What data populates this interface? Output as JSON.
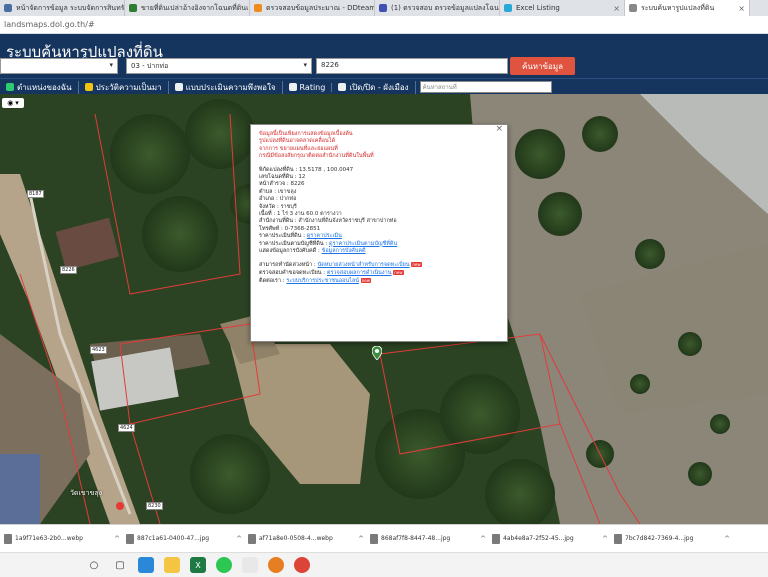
{
  "browser": {
    "tabs": [
      {
        "label": "หน้าจัดการข้อมูล ระบบจัดการสินทรัพย์ CST11",
        "color": "#4a6fa5",
        "active": false
      },
      {
        "label": "ขายที่ดินเปล่าอ้างอิงจากโฉนดที่ดินเลขที่ (4...",
        "color": "#2e7d32",
        "active": false
      },
      {
        "label": "ตรวจสอบข้อมูลประมาณ - DDteamian",
        "color": "#ef8a1f",
        "active": false
      },
      {
        "label": "(1) ตรวจสอบ ตรวจข้อมูลแปลงโฉนดปาก...",
        "color": "#3f51b5",
        "active": false
      },
      {
        "label": "Excel Listing",
        "color": "#2aa8d8",
        "active": false
      },
      {
        "label": "ระบบค้นหารูปแปลงที่ดิน",
        "color": "#888888",
        "active": true
      }
    ],
    "url": "landsmaps.dol.go.th/#"
  },
  "app": {
    "title": "ระบบค้นหารูปแปลงที่ดิน",
    "province_value": "",
    "district_value": "03 - ปากท่อ",
    "parcel_value": "8226",
    "search_label": "ค้นหาข้อมูล",
    "accent": "#e0533f",
    "header_color": "#16355e"
  },
  "toolbar": {
    "items": [
      {
        "label": "ตำแหน่งของฉัน",
        "icon": "location-icon",
        "color": "#2ecc71"
      },
      {
        "label": "ประวัติความเป็นมา",
        "icon": "history-icon",
        "color": "#f1c40f"
      },
      {
        "label": "แบบประเมินความพึงพอใจ",
        "icon": "survey-icon",
        "color": "#ecf0f1"
      },
      {
        "label": "Rating",
        "icon": "rating-icon",
        "color": "#ecf0f1"
      },
      {
        "label": "เปิด/ปิด - ผังเมือง",
        "icon": "toggle-icon",
        "color": "#ecf0f1"
      }
    ],
    "search_placeholder": "ค้นหาสถานที่"
  },
  "popup": {
    "warnings": [
      "ข้อมูลนี้เป็นเพียงการแสดงข้อมูลเบื้องต้น",
      "รูปแปลงที่ดินอาจคลาดเคลื่อนได้",
      "จากการ ขยายแผนที่และย่อแผนที่",
      "กรณีมีข้อสงสัยกรุณาติดต่อสำนักงานที่ดินในพื้นที่"
    ],
    "fields": [
      {
        "label": "พิกัดแปลงที่ดิน",
        "value": "13.5178 , 100.0047"
      },
      {
        "label": "เลขโฉนดที่ดิน",
        "value": "12"
      },
      {
        "label": "หน้าสำรวจ",
        "value": "8226"
      },
      {
        "label": "ตำบล",
        "value": "เขาขลุง"
      },
      {
        "label": "อำเภอ",
        "value": "ปากท่อ"
      },
      {
        "label": "จังหวัด",
        "value": "ราชบุรี"
      },
      {
        "label": "เนื้อที่",
        "value": "1 ไร่ 3 งาน 60.0 ตารางวา"
      },
      {
        "label": "สำนักงานที่ดิน",
        "value": "สำนักงานที่ดินจังหวัดราชบุรี สาขาปากท่อ"
      },
      {
        "label": "โทรศัพท์",
        "value": "0-7368-2851"
      },
      {
        "label": "ราคาประเมินที่ดิน",
        "value": "ดูราคาประเมิน"
      },
      {
        "label": "ราคาประเมินตามบัญชีที่ดิน",
        "value": "ดูราคาประเมินตามบัญชีที่ดิน"
      },
      {
        "label": "แสดงข้อมูลการบังคับคดี",
        "value": "ข้อมูลการบังคับคดี"
      }
    ],
    "links": [
      {
        "label": "สามารถทำนัดล่วงหน้า",
        "text": "นัดหมายล่วงหน้าสำหรับการจดทะเบียน"
      },
      {
        "label": "ตรวจสอบคำขอจดทะเบียน",
        "text": "ตรวจสอบผลการดำเนินงาน"
      },
      {
        "label": "ติดต่อเรา",
        "text": "ระบบบริการประชาชนออนไลน์"
      }
    ]
  },
  "map": {
    "parcel_labels": [
      "8187",
      "8226",
      "4623",
      "4624",
      "8230"
    ],
    "place_label": "วัดเขาขลุง"
  },
  "downloads": [
    {
      "name": "1a9f71e63-2b0...webp"
    },
    {
      "name": "887c1a61-0400-47...jpg"
    },
    {
      "name": "af71a8e0-0508-4...webp"
    },
    {
      "name": "868af7f8-8447-48...jpg"
    },
    {
      "name": "4ab4e8a7-2f52-45...jpg"
    },
    {
      "name": "7bc7d842-7369-4...jpg"
    }
  ]
}
